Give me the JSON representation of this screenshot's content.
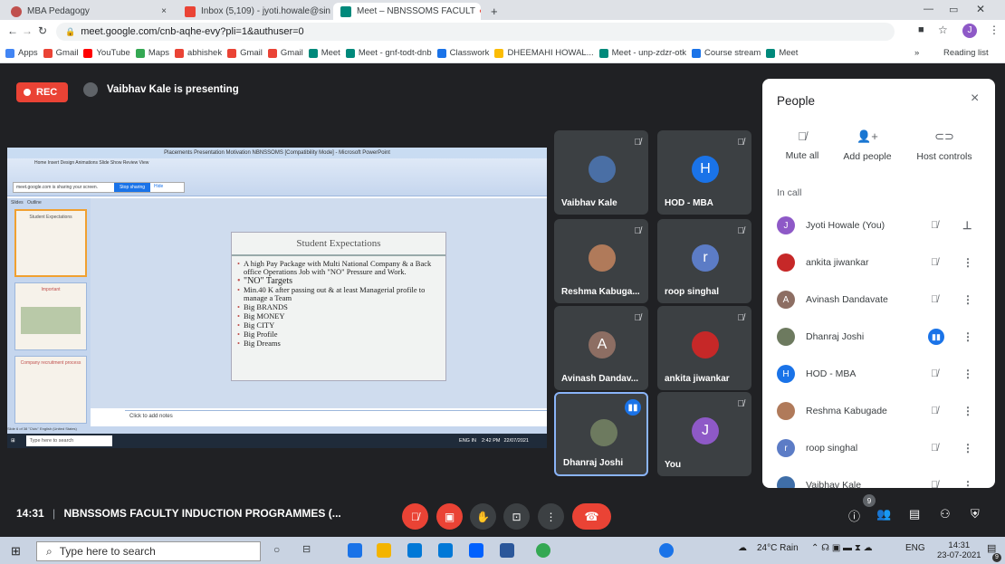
{
  "browser": {
    "tabs": [
      {
        "title": "MBA Pedagogy",
        "close": "×"
      },
      {
        "title": "Inbox (5,109) - jyoti.howale@sin",
        "close": "×"
      },
      {
        "title": "Meet – NBNSSOMS FACULT",
        "close": "×"
      },
      {
        "title": "+",
        "close": ""
      }
    ],
    "url": "meet.google.com/cnb-aqhe-evy?pli=1&authuser=0",
    "profile_initial": "J",
    "bookmarks": [
      "Apps",
      "Gmail",
      "YouTube",
      "Maps",
      "abhishek",
      "Gmail",
      "Gmail",
      "Meet",
      "Meet - gnf-todt-dnb",
      "Classwork",
      "DHEEMAHI HOWAL...",
      "Meet - unp-zdzr-otk",
      "Course stream",
      "Meet"
    ],
    "reading_list": "Reading list",
    "more_bookmarks": "»"
  },
  "meet": {
    "rec_label": "REC",
    "presenting_text": "Vaibhav Kale is presenting",
    "meeting_time": "14:31",
    "meeting_separator": "|",
    "meeting_title": "NBNSSOMS FACULTY INDUCTION PROGRAMMES (...",
    "participant_count": "9"
  },
  "shared_screen": {
    "window_title": "Placements Presentation Motivation NBNSSOMS [Compatibility Mode] - Microsoft PowerPoint",
    "ribbon_tabs": "Home   Insert   Design   Animations   Slide Show   Review   View",
    "sharing_text": "meet.google.com is sharing your screen.",
    "stop_sharing": "Stop sharing",
    "hide": "Hide",
    "slides_tab": "Slides",
    "outline_tab": "Outline",
    "thumb_titles": [
      "Student Expectations",
      "Important",
      "Company recruitment process"
    ],
    "slide_title": "Student Expectations",
    "slide_bullets": [
      "A high Pay Package with Multi National Company & a Back office Operations Job with \"NO\" Pressure and Work.",
      "\"NO\" Targets",
      "Min.40 K after passing out & at least Managerial profile to manage a Team",
      "Big BRANDS",
      "Big MONEY",
      "Big CITY",
      "Big Profile",
      "Big Dreams"
    ],
    "notes_placeholder": "Click to add notes",
    "status_left": "Slide 6 of 38   \"Civic\"   English (United States)",
    "taskbar_search": "Type here to search",
    "taskbar_time": "2:42 PM",
    "taskbar_date": "22/07/2021",
    "taskbar_lang": "ENG IN"
  },
  "tiles": [
    {
      "name": "Vaibhav Kale",
      "avatar": "",
      "color": "#3c4043"
    },
    {
      "name": "HOD - MBA",
      "avatar": "H",
      "color": "#1a73e8"
    },
    {
      "name": "Reshma Kabuga...",
      "avatar": "",
      "color": "#3c4043"
    },
    {
      "name": "roop singhal",
      "avatar": "r",
      "color": "#5c7cc6"
    },
    {
      "name": "Avinash Dandav...",
      "avatar": "A",
      "color": "#8d6e63"
    },
    {
      "name": "ankita jiwankar",
      "avatar": "",
      "color": "#c62828"
    },
    {
      "name": "Dhanraj Joshi",
      "avatar": "",
      "color": "#5f6368"
    },
    {
      "name": "You",
      "avatar": "J",
      "color": "#8e59c7"
    }
  ],
  "people": {
    "title": "People",
    "close": "×",
    "actions": [
      "Mute all",
      "Add people",
      "Host controls"
    ],
    "in_call_label": "In call",
    "list": [
      {
        "name": "Jyoti Howale (You)",
        "avatar": "J",
        "color": "#8e59c7"
      },
      {
        "name": "ankita jiwankar",
        "avatar": "",
        "color": "#c62828"
      },
      {
        "name": "Avinash Dandavate",
        "avatar": "A",
        "color": "#8d6e63"
      },
      {
        "name": "Dhanraj Joshi",
        "avatar": "",
        "color": "#6d7a5f"
      },
      {
        "name": "HOD - MBA",
        "avatar": "H",
        "color": "#1a73e8"
      },
      {
        "name": "Reshma Kabugade",
        "avatar": "",
        "color": "#b07a5a"
      },
      {
        "name": "roop singhal",
        "avatar": "r",
        "color": "#5c7cc6"
      },
      {
        "name": "Vaibhav Kale",
        "avatar": "",
        "color": "#3f6ea8"
      }
    ]
  },
  "taskbar": {
    "search_placeholder": "Type here to search",
    "weather": "24°C  Rain",
    "lang": "ENG",
    "time": "14:31",
    "date": "23-07-2021",
    "notif_count": "9"
  },
  "colors": {
    "accent": "#1a73e8",
    "danger": "#ea4335",
    "meet_bg": "#202124",
    "tile_bg": "#3c4043"
  }
}
